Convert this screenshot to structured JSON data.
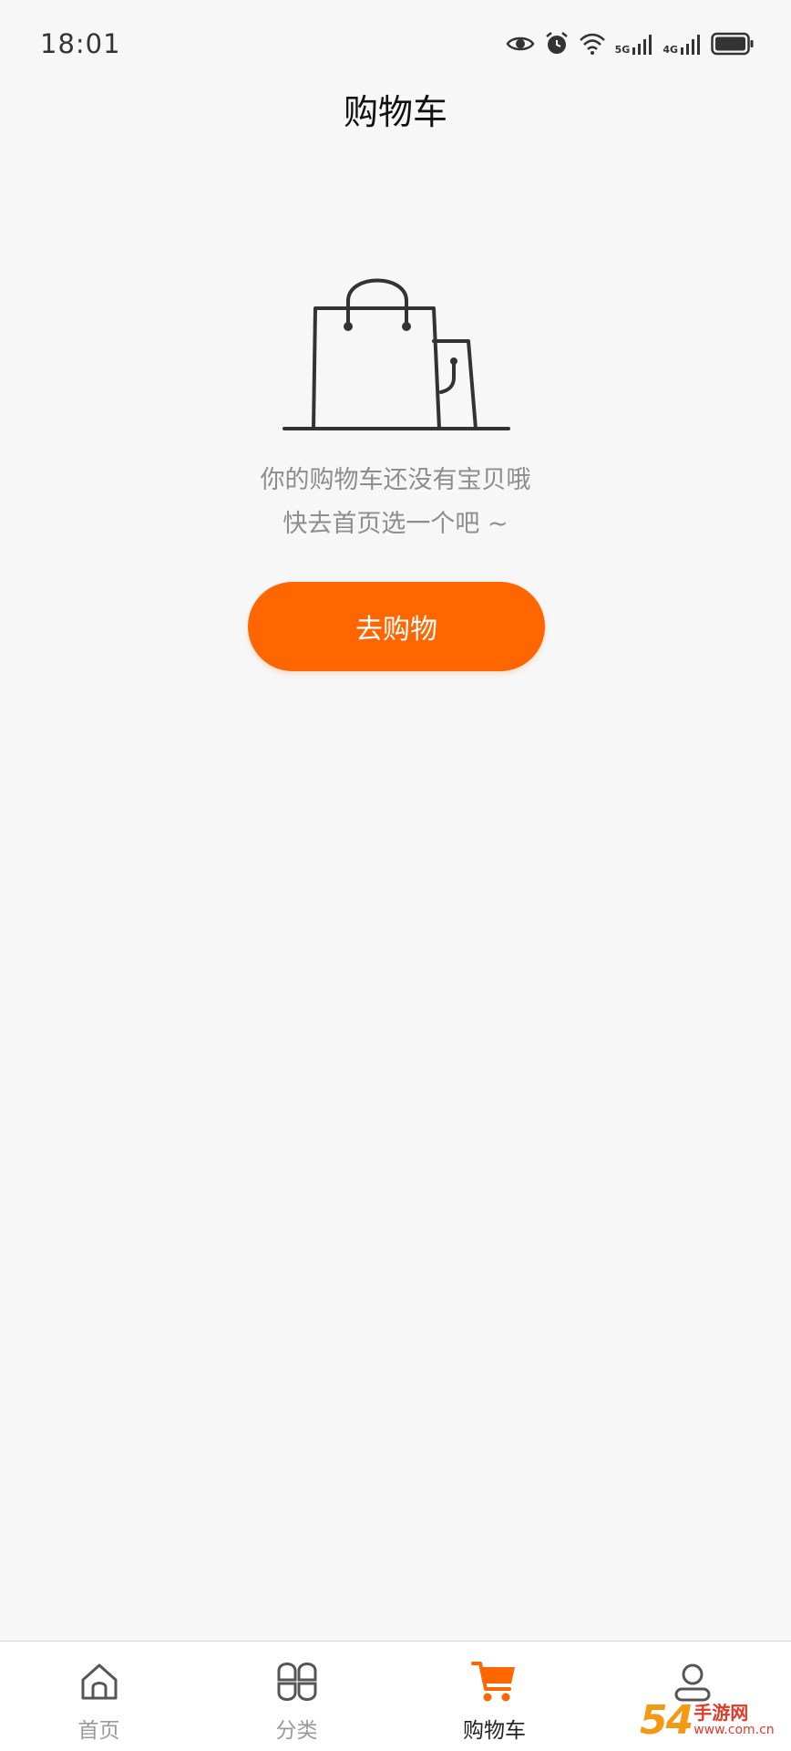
{
  "status_bar": {
    "time": "18:01",
    "net1": "5G",
    "net2": "4G"
  },
  "header": {
    "title": "购物车"
  },
  "empty_state": {
    "icon": "shopping-bag-icon",
    "line1": "你的购物车还没有宝贝哦",
    "line2": "快去首页选一个吧 ~",
    "button_label": "去购物"
  },
  "tab_bar": {
    "tabs": [
      {
        "label": "首页",
        "icon": "home-icon",
        "active": false
      },
      {
        "label": "分类",
        "icon": "category-icon",
        "active": false
      },
      {
        "label": "购物车",
        "icon": "cart-icon",
        "active": true
      },
      {
        "label": "",
        "icon": "user-icon",
        "active": false
      }
    ]
  },
  "colors": {
    "accent": "#ff6600",
    "background": "#f7f7f7",
    "muted_text": "#8d8d8d"
  },
  "watermark": {
    "digits": "54",
    "brand": "手游网",
    "url": "www.com.cn"
  }
}
